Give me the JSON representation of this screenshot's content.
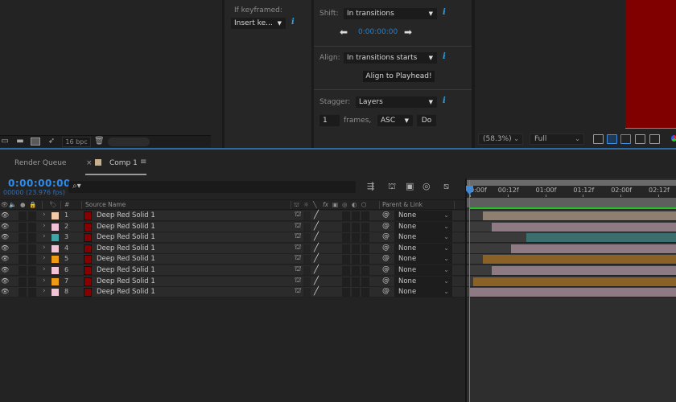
{
  "project_panel": {
    "footer": {
      "icons": [
        "interpret-footage-icon",
        "new-folder-icon",
        "new-composition-icon",
        "render-rocket-icon",
        "trash-icon"
      ],
      "bit_depth": "16 bpc"
    }
  },
  "keyframe_panel": {
    "label": "If keyframed:",
    "dropdown_value": "Insert ke...",
    "info": "i"
  },
  "options_panel": {
    "shift_label": "Shift:",
    "shift_value": "In transitions",
    "time_value": "0:00:00:00",
    "align_label": "Align:",
    "align_value": "In transitions starts",
    "align_button": "Align to Playhead!",
    "stagger_label": "Stagger:",
    "stagger_value": "Layers",
    "frames_value": "1",
    "frames_label": "frames,",
    "order_value": "ASC",
    "do_button": "Do",
    "info": "i"
  },
  "viewer": {
    "zoom": "(58.3%)",
    "resolution": "Full",
    "comp_color": "#800000"
  },
  "timeline": {
    "tabs": [
      {
        "label": "Render Queue",
        "active": false
      },
      {
        "label": "Comp 1",
        "active": true,
        "close": "×",
        "menu": "≡",
        "swatch": "#c8b08a"
      }
    ],
    "timecode": "0:00:00:00",
    "frame_info": "00000 (23.976 fps)",
    "search_placeholder": "",
    "columns": {
      "number": "#",
      "source_name": "Source Name",
      "parent_link": "Parent & Link"
    },
    "ruler": [
      "0:00f",
      "00:12f",
      "01:00f",
      "01:12f",
      "02:00f",
      "02:12f"
    ],
    "layers": [
      {
        "num": "1",
        "name": "Deep Red Solid 1",
        "label_color": "#f2cba8",
        "parent": "None",
        "bar_color": "#8f7f70",
        "in_frame": 4
      },
      {
        "num": "2",
        "name": "Deep Red Solid 1",
        "label_color": "#f0c4d4",
        "parent": "None",
        "bar_color": "#8d7a82",
        "in_frame": 7
      },
      {
        "num": "3",
        "name": "Deep Red Solid 1",
        "label_color": "#3da6a6",
        "parent": "None",
        "bar_color": "#3d6e6e",
        "in_frame": 18
      },
      {
        "num": "4",
        "name": "Deep Red Solid 1",
        "label_color": "#f0c4d4",
        "parent": "None",
        "bar_color": "#8d7a82",
        "in_frame": 13
      },
      {
        "num": "5",
        "name": "Deep Red Solid 1",
        "label_color": "#ee9a14",
        "parent": "None",
        "bar_color": "#8a6228",
        "in_frame": 4
      },
      {
        "num": "6",
        "name": "Deep Red Solid 1",
        "label_color": "#f0c4d4",
        "parent": "None",
        "bar_color": "#8d7a82",
        "in_frame": 7
      },
      {
        "num": "7",
        "name": "Deep Red Solid 1",
        "label_color": "#ee9a14",
        "parent": "None",
        "bar_color": "#8a6228",
        "in_frame": 1
      },
      {
        "num": "8",
        "name": "Deep Red Solid 1",
        "label_color": "#f0c4d4",
        "parent": "None",
        "bar_color": "#8d7a82",
        "in_frame": 0
      }
    ]
  }
}
